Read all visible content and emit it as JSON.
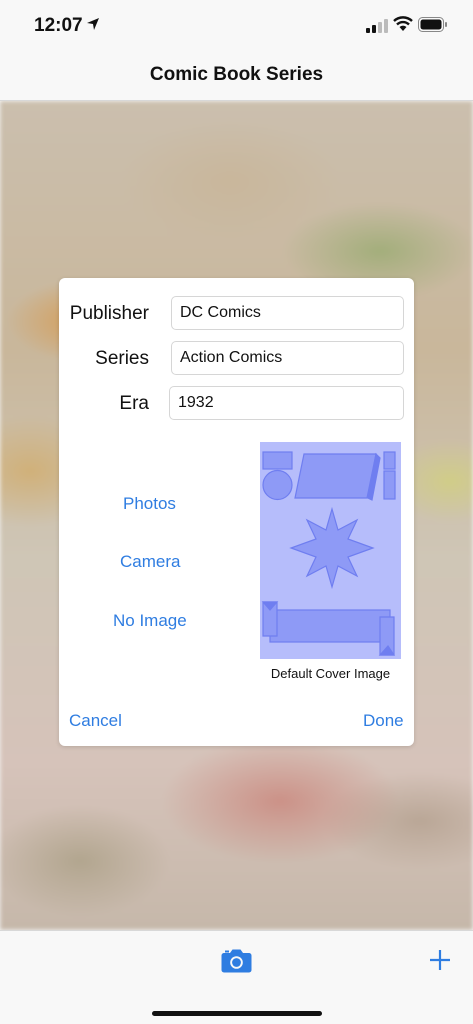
{
  "status_bar": {
    "time": "12:07"
  },
  "nav": {
    "title": "Comic Book Series"
  },
  "form": {
    "publisher_label": "Publisher",
    "publisher_value": "DC Comics",
    "series_label": "Series",
    "series_value": "Action Comics",
    "era_label": "Era",
    "era_value": "1932"
  },
  "image_options": {
    "photos": "Photos",
    "camera": "Camera",
    "no_image": "No Image",
    "cover_caption": "Default Cover Image"
  },
  "dialog_actions": {
    "cancel": "Cancel",
    "done": "Done"
  },
  "toolbar": {
    "camera_icon": "camera-icon",
    "add_icon": "plus-icon"
  },
  "colors": {
    "accent": "#2f7de1",
    "cover_bg": "#b6bdfb",
    "cover_shape": "#8e9af6"
  }
}
